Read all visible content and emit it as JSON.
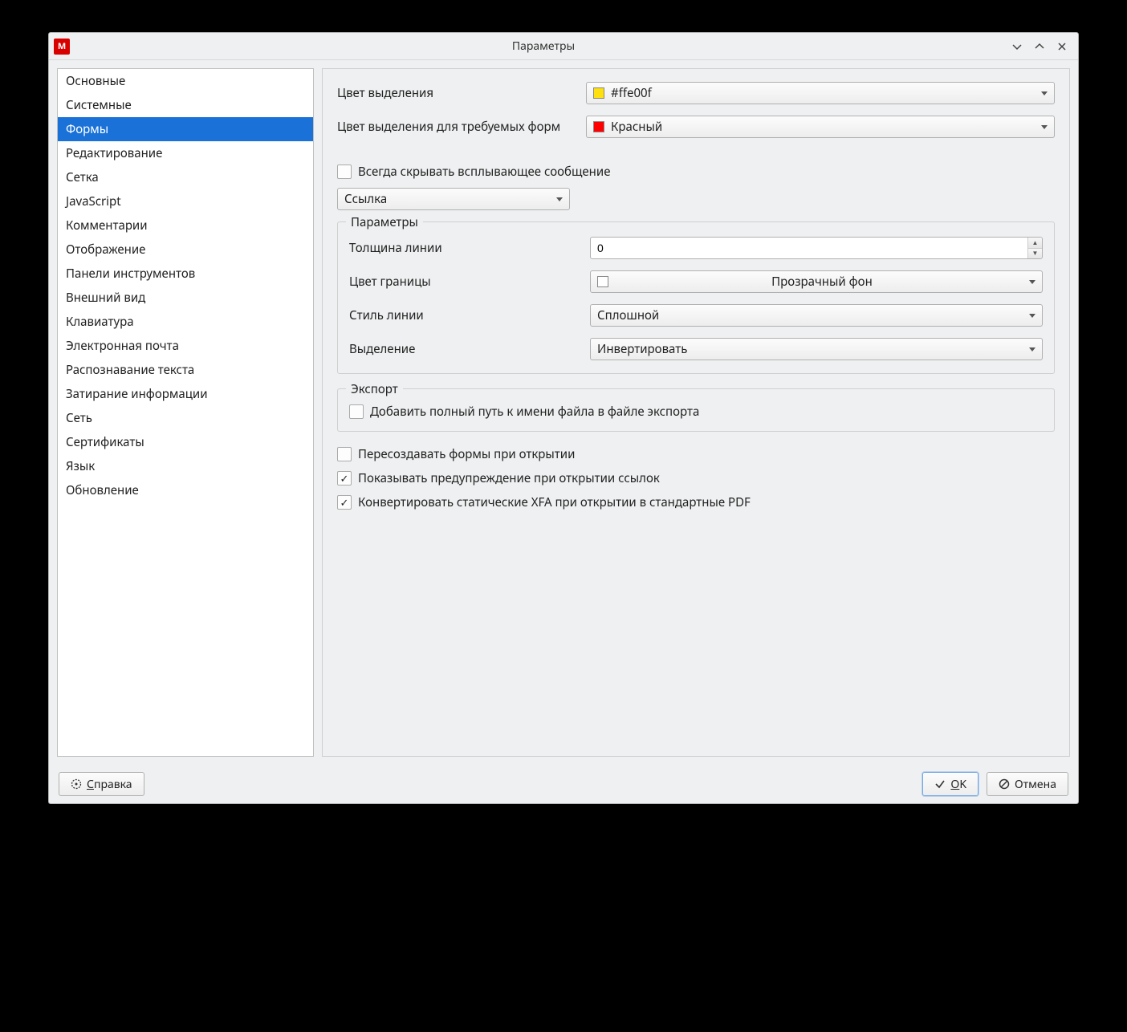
{
  "window": {
    "title": "Параметры"
  },
  "sidebar": {
    "items": [
      "Основные",
      "Системные",
      "Формы",
      "Редактирование",
      "Сетка",
      "JavaScript",
      "Комментарии",
      "Отображение",
      "Панели инструментов",
      "Внешний вид",
      "Клавиатура",
      "Электронная почта",
      "Распознавание текста",
      "Затирание информации",
      "Сеть",
      "Сертификаты",
      "Язык",
      "Обновление"
    ],
    "selected_index": 2
  },
  "main": {
    "highlight_color_label": "Цвет выделения",
    "highlight_color_value": "#ffe00f",
    "highlight_color_swatch": "#ffe00f",
    "required_color_label": "Цвет выделения для требуемых форм",
    "required_color_value": "Красный",
    "required_color_swatch": "#ff0000",
    "always_hide_label": "Всегда скрывать всплывающее сообщение",
    "always_hide_checked": false,
    "object_dropdown_value": "Ссылка",
    "params_group_title": "Параметры",
    "line_width_label": "Толщина линии",
    "line_width_value": "0",
    "border_color_label": "Цвет границы",
    "border_color_value": "Прозрачный фон",
    "line_style_label": "Стиль линии",
    "line_style_value": "Сплошной",
    "highlight_mode_label": "Выделение",
    "highlight_mode_value": "Инвертировать",
    "export_group_title": "Экспорт",
    "export_fullpath_label": "Добавить полный путь к имени файла в файле экспорта",
    "export_fullpath_checked": false,
    "recreate_forms_label": "Пересоздавать формы при открытии",
    "recreate_forms_checked": false,
    "warn_links_label": "Показывать предупреждение при открытии ссылок",
    "warn_links_checked": true,
    "convert_xfa_label": "Конвертировать статические XFA при открытии в стандартные PDF",
    "convert_xfa_checked": true
  },
  "footer": {
    "help_label": "Справка",
    "ok_label": "OK",
    "cancel_label": "Отмена"
  }
}
